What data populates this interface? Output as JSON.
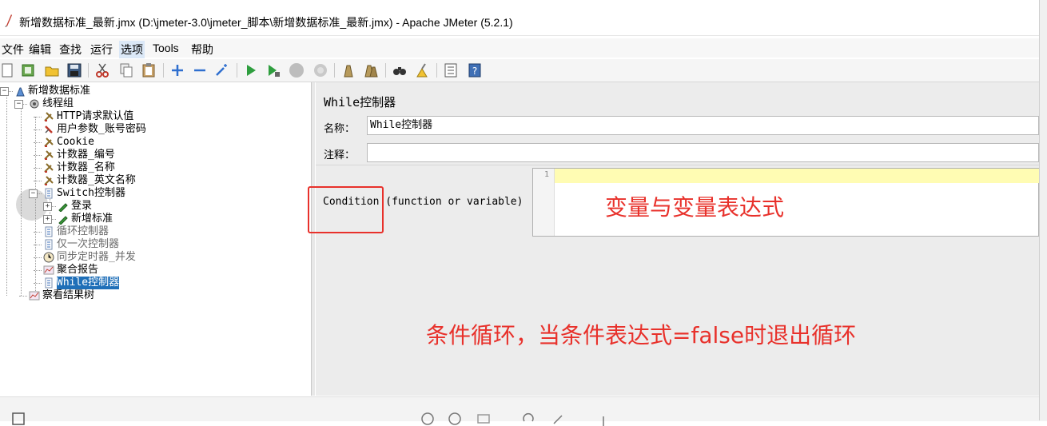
{
  "window": {
    "title": "新增数据标准_最新.jmx (D:\\jmeter-3.0\\jmeter_脚本\\新增数据标准_最新.jmx) - Apache JMeter (5.2.1)"
  },
  "menu": {
    "items": [
      {
        "label": "文件"
      },
      {
        "label": "编辑"
      },
      {
        "label": "查找"
      },
      {
        "label": "运行"
      },
      {
        "label": "选项"
      },
      {
        "label": "Tools"
      },
      {
        "label": "帮助"
      }
    ]
  },
  "toolbar": {
    "icons": [
      "new-icon",
      "templates-icon",
      "open-icon",
      "save-icon",
      "cut-icon",
      "copy-icon",
      "paste-icon",
      "expand-icon",
      "collapse-icon",
      "toggle-icon",
      "start-icon",
      "start-no-pause-icon",
      "stop-icon",
      "shutdown-icon",
      "clear-icon",
      "clear-all-icon",
      "search-icon",
      "reset-search-icon",
      "function-helper-icon",
      "help-icon"
    ]
  },
  "tree": {
    "nodes": [
      {
        "label": "新增数据标准",
        "level": 0,
        "icon": "test-plan-icon",
        "expanded": true,
        "gray": false
      },
      {
        "label": "线程组",
        "level": 1,
        "icon": "thread-group-icon",
        "expanded": true,
        "gray": false
      },
      {
        "label": "HTTP请求默认值",
        "level": 2,
        "icon": "config-wrench-icon",
        "gray": false
      },
      {
        "label": "用户参数_账号密码",
        "level": 2,
        "icon": "preprocessor-icon",
        "gray": false
      },
      {
        "label": "Cookie",
        "level": 2,
        "icon": "config-wrench-icon",
        "gray": false
      },
      {
        "label": "计数器_编号",
        "level": 2,
        "icon": "config-wrench-icon",
        "gray": false
      },
      {
        "label": "计数器_名称",
        "level": 2,
        "icon": "config-wrench-icon",
        "gray": false
      },
      {
        "label": "计数器_英文名称",
        "level": 2,
        "icon": "config-wrench-icon",
        "gray": false
      },
      {
        "label": "Switch控制器",
        "level": 2,
        "icon": "controller-icon",
        "expanded": true,
        "gray": false
      },
      {
        "label": "登录",
        "level": 3,
        "icon": "sampler-pencil-icon",
        "collapsed": true,
        "gray": false
      },
      {
        "label": "新增标准",
        "level": 3,
        "icon": "sampler-pencil-icon",
        "collapsed": true,
        "gray": false
      },
      {
        "label": "循环控制器",
        "level": 2,
        "icon": "controller-icon",
        "gray": true
      },
      {
        "label": "仅一次控制器",
        "level": 2,
        "icon": "controller-icon",
        "gray": true
      },
      {
        "label": "同步定时器_并发",
        "level": 2,
        "icon": "timer-icon",
        "gray": true
      },
      {
        "label": "聚合报告",
        "level": 2,
        "icon": "listener-graph-icon",
        "gray": false
      },
      {
        "label": "While控制器",
        "level": 2,
        "icon": "controller-icon",
        "selected": true,
        "gray": false
      },
      {
        "label": "察看结果树",
        "level": 1,
        "icon": "listener-graph-icon",
        "gray": false
      }
    ]
  },
  "panel": {
    "heading": "While控制器",
    "name_label": "名称：",
    "name_value": "While控制器",
    "comment_label": "注释：",
    "comment_value": "",
    "condition_label": "Condition (function or variable)",
    "editor_line_number": "1",
    "editor_value": ""
  },
  "annotations": {
    "editor_note": "变量与变量表达式",
    "bottom_note": "条件循环，当条件表达式=false时退出循环"
  },
  "colors": {
    "annotation": "#e8312b",
    "selection": "#1f6fb8",
    "editor_current_line": "#fffcb3"
  }
}
